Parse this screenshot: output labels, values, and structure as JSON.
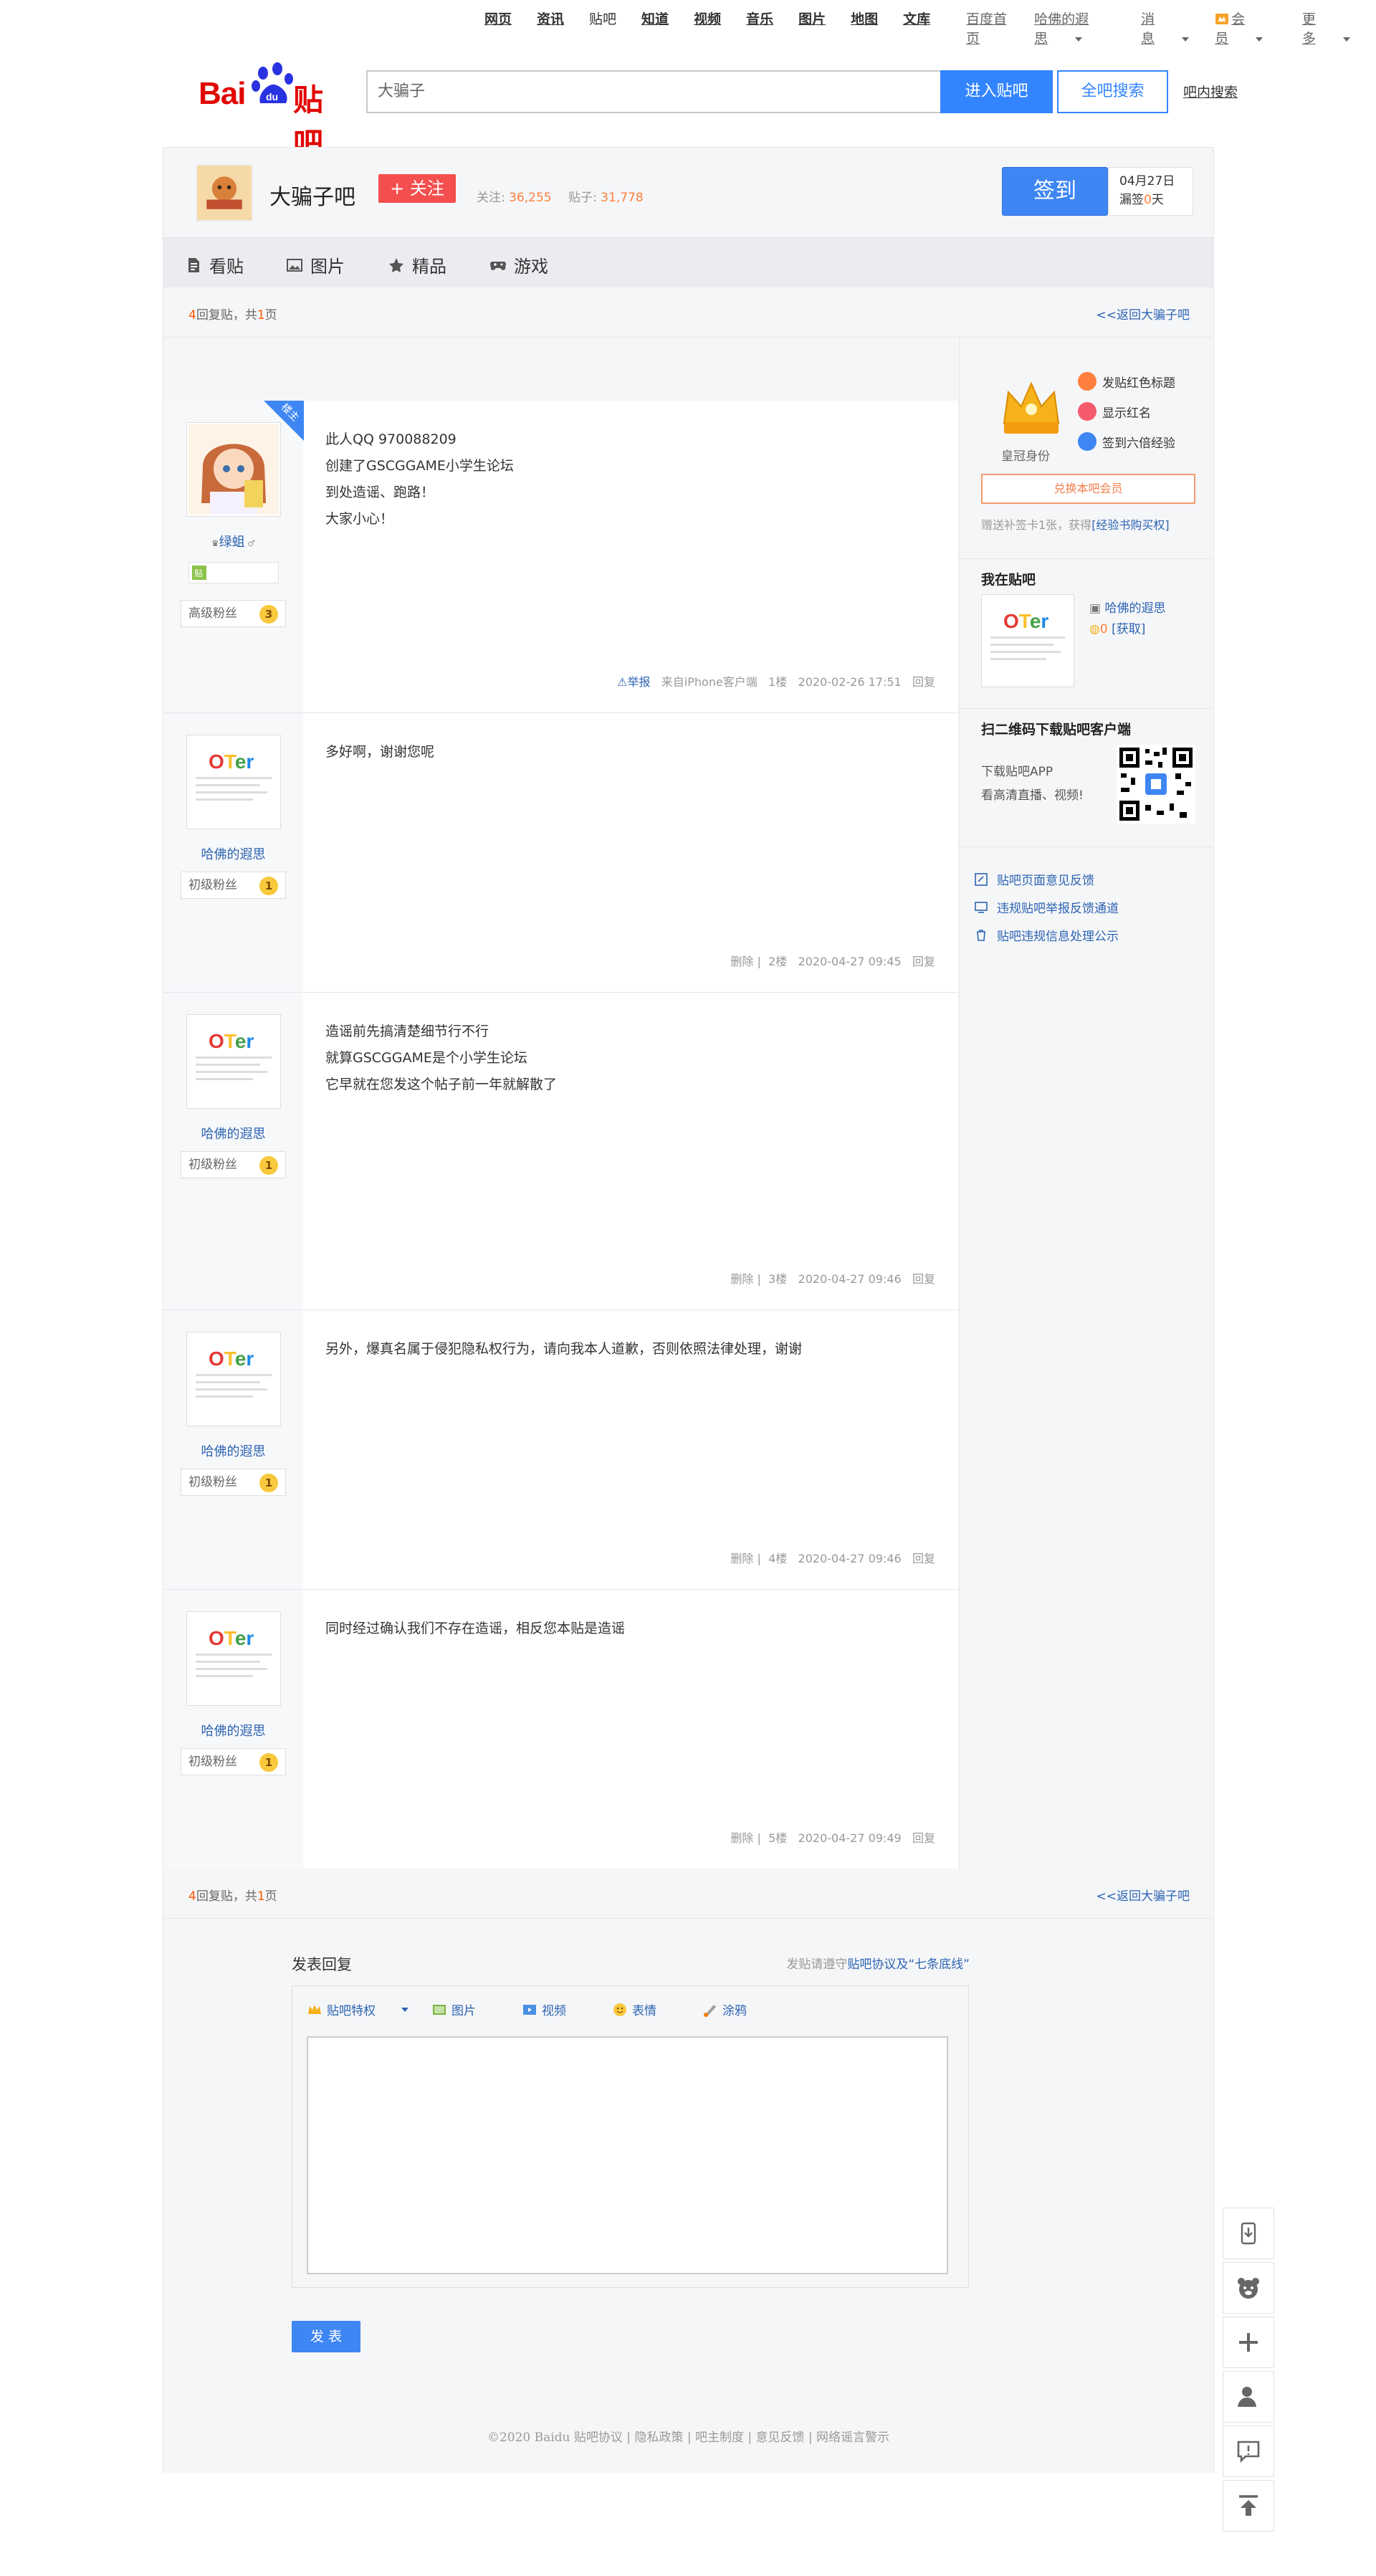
{
  "topnav": {
    "left_links": [
      "网页",
      "资讯",
      "贴吧",
      "知道",
      "视频",
      "音乐",
      "图片",
      "地图",
      "文库"
    ],
    "right_links": [
      "百度首页",
      "哈佛的遐思",
      "消息",
      "会员",
      "更多"
    ]
  },
  "search": {
    "value": "大骗子",
    "enter_label": "进入贴吧",
    "all_label": "全吧搜索",
    "inner_label": "吧内搜索"
  },
  "forum": {
    "name": "大骗子吧",
    "follow_label": "+ 关注",
    "followers_label": "关注:",
    "followers": "36,255",
    "posts_label": "贴子:",
    "posts": "31,778",
    "sign_label": "签到",
    "sign_date": "04月27日",
    "sign_missed_prefix": "漏签",
    "sign_missed_count": "0",
    "sign_missed_suffix": "天"
  },
  "tabs": [
    {
      "label": "看贴",
      "icon": "document-icon"
    },
    {
      "label": "图片",
      "icon": "image-icon"
    },
    {
      "label": "精品",
      "icon": "star-icon"
    },
    {
      "label": "游戏",
      "icon": "gamepad-icon"
    }
  ],
  "pager": {
    "count": "4",
    "text_mid": "回复贴，共",
    "pages": "1",
    "text_end": "页",
    "back": "<<返回大骗子吧"
  },
  "posts": [
    {
      "username": "绿蛆",
      "badge": "高级粉丝",
      "level": "3",
      "lines": [
        "此人QQ 970088209",
        "创建了GSCGGAME小学生论坛",
        "到处造谣、跑路！",
        "大家小心！"
      ],
      "report": "举报",
      "client": "来自iPhone客户端",
      "floor": "1楼",
      "time": "2020-02-26 17:51",
      "reply": "回复",
      "tag": "楼主"
    },
    {
      "username": "哈佛的遐思",
      "badge": "初级粉丝",
      "level": "1",
      "lines": [
        "多好啊，谢谢您呢"
      ],
      "delete": "删除",
      "floor": "2楼",
      "time": "2020-04-27 09:45",
      "reply": "回复"
    },
    {
      "username": "哈佛的遐思",
      "badge": "初级粉丝",
      "level": "1",
      "lines": [
        "造谣前先搞清楚细节行不行",
        "就算GSCGGAME是个小学生论坛",
        "它早就在您发这个帖子前一年就解散了"
      ],
      "delete": "删除",
      "floor": "3楼",
      "time": "2020-04-27 09:46",
      "reply": "回复"
    },
    {
      "username": "哈佛的遐思",
      "badge": "初级粉丝",
      "level": "1",
      "lines": [
        "另外，爆真名属于侵犯隐私权行为，请向我本人道歉，否则依照法律处理，谢谢"
      ],
      "delete": "删除",
      "floor": "4楼",
      "time": "2020-04-27 09:46",
      "reply": "回复"
    },
    {
      "username": "哈佛的遐思",
      "badge": "初级粉丝",
      "level": "1",
      "lines": [
        "同时经过确认我们不存在造谣，相反您本贴是造谣"
      ],
      "delete": "删除",
      "floor": "5楼",
      "time": "2020-04-27 09:49",
      "reply": "回复"
    }
  ],
  "aside": {
    "crown_label": "皇冠身份",
    "perks": [
      "发贴红色标题",
      "显示红名",
      "签到六倍经验"
    ],
    "exchange_label": "兑换本吧会员",
    "note_prefix": "赠送补签卡1张，获得",
    "note_link": "[经验书购买权]",
    "mine_title": "我在贴吧",
    "mine_name": "哈佛的遐思",
    "mine_coins": "0",
    "mine_get": "[获取]",
    "qr_title": "扫二维码下载贴吧客户端",
    "qr_line1": "下载贴吧APP",
    "qr_line2": "看高清直播、视频!",
    "feedback": [
      "贴吧页面意见反馈",
      "违规贴吧举报反馈通道",
      "贴吧违规信息处理公示"
    ]
  },
  "reply": {
    "title": "发表回复",
    "rule_prefix": "发贴请遵守",
    "rule_link": "贴吧协议及“七条底线”",
    "toolbar": [
      "贴吧特权",
      "图片",
      "视频",
      "表情",
      "涂鸦"
    ],
    "post_label": "发 表"
  },
  "footer": {
    "text": "©2020 Baidu  贴吧协议 | 隐私政策 | 吧主制度 | 意见反馈 | 网络谣言警示"
  },
  "floatbar": [
    "download-icon",
    "bear-icon",
    "plus-icon",
    "user-icon",
    "feedback-icon",
    "top-icon"
  ],
  "colors": {
    "accent": "#3385ff",
    "orange": "#ff7f3e",
    "follow_red": "#f54e4e"
  }
}
